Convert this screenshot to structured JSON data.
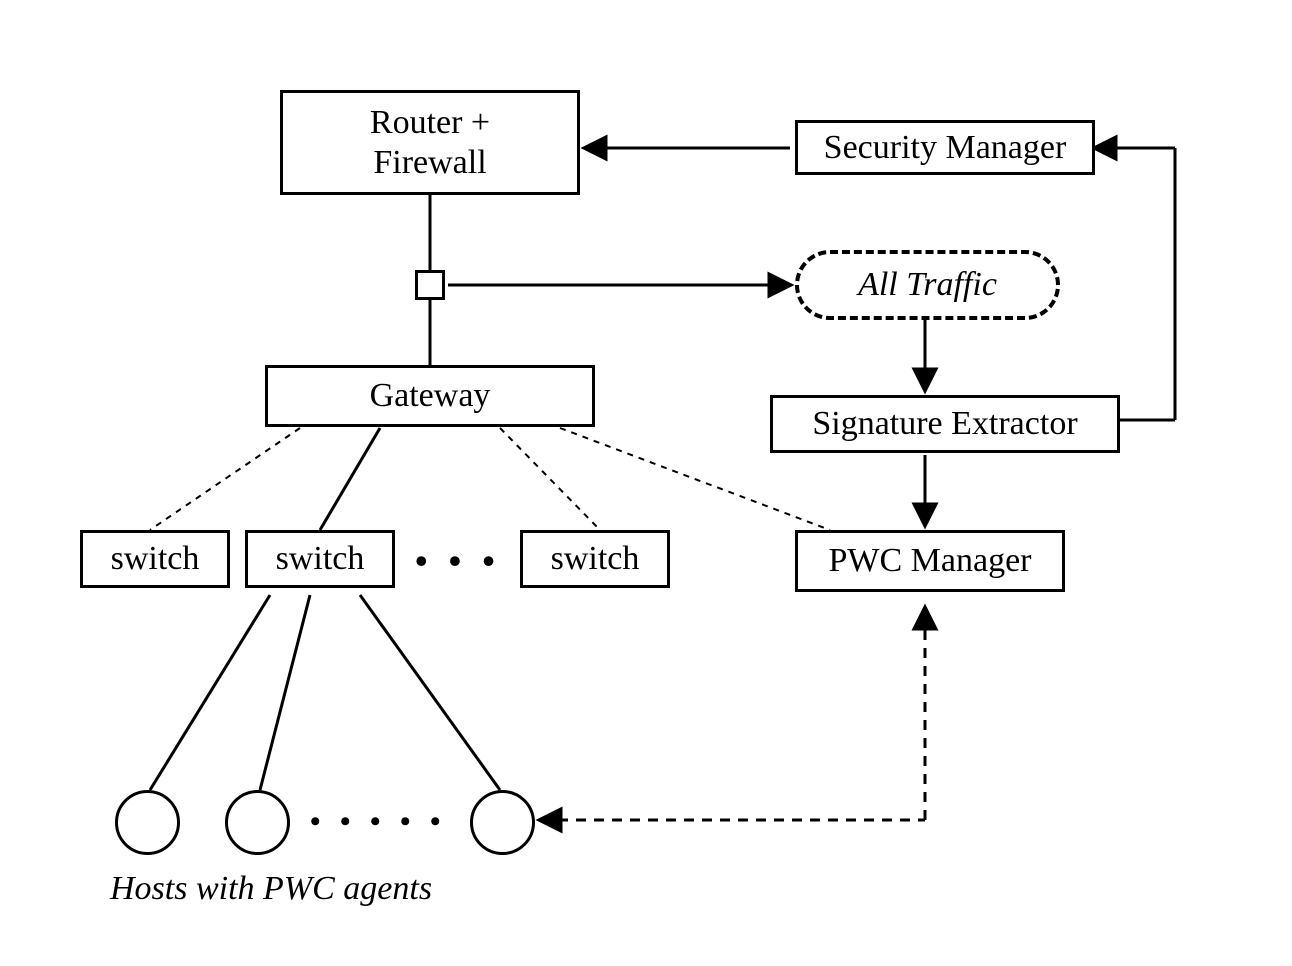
{
  "nodes": {
    "router_firewall": "Router +\nFirewall",
    "security_manager": "Security Manager",
    "all_traffic": "All Traffic",
    "gateway": "Gateway",
    "signature_extractor": "Signature Extractor",
    "pwc_manager": "PWC Manager",
    "switch1": "switch",
    "switch2": "switch",
    "switch3": "switch"
  },
  "ellipsis": {
    "switches": "• • •",
    "hosts": "• • • • •"
  },
  "caption": "Hosts with PWC agents"
}
